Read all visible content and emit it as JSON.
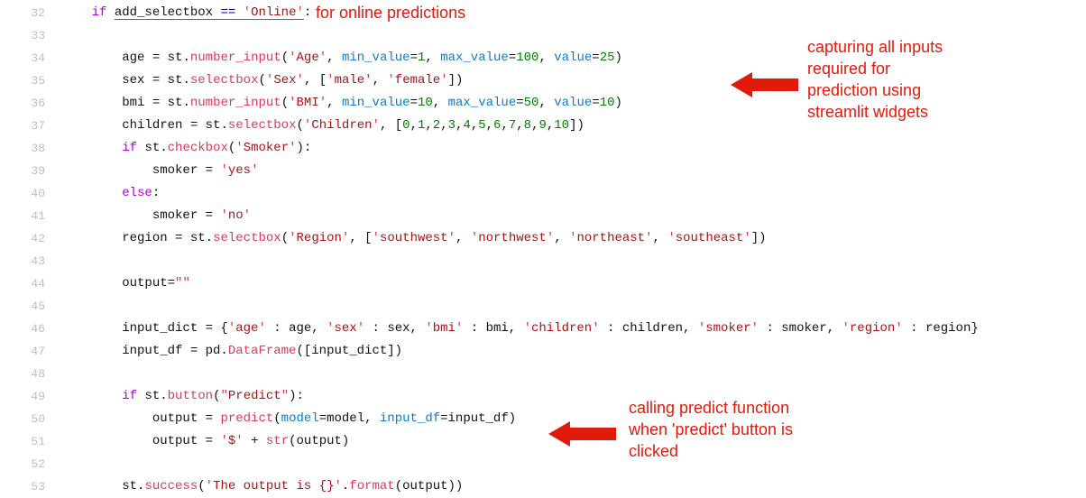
{
  "gutter": {
    "start": 32,
    "end": 53
  },
  "colors": {
    "str": "#a31515",
    "kw": "#af00db",
    "fn": "#dc3958",
    "num": "#008000",
    "param": "#0e7acc",
    "op": "#000080",
    "annot": "#e11a0c"
  },
  "code": {
    "l32": {
      "indent1": "    ",
      "if": "if",
      "sp1": " ",
      "var": "add_selectbox",
      "sp2": " ",
      "eq": "==",
      "sp3": " ",
      "q1": "'",
      "s": "Online",
      "q2": "'",
      "colon": ":"
    },
    "l34": {
      "indent": "        ",
      "lhs": "age",
      "assign": " = ",
      "obj": "st.",
      "fn": "number_input",
      "open": "(",
      "q1": "'",
      "s": "Age",
      "q2": "'",
      "c1": ", ",
      "p1": "min_value",
      "eq1": "=",
      "n1": "1",
      "c2": ", ",
      "p2": "max_value",
      "eq2": "=",
      "n2": "100",
      "c3": ", ",
      "p3": "value",
      "eq3": "=",
      "n3": "25",
      "close": ")"
    },
    "l35": {
      "indent": "        ",
      "lhs": "sex",
      "assign": " = ",
      "obj": "st.",
      "fn": "selectbox",
      "open": "(",
      "q1": "'",
      "s": "Sex",
      "q2": "'",
      "c1": ", [",
      "qa": "'",
      "a": "male",
      "qb": "'",
      "c2": ", ",
      "qc": "'",
      "b": "female",
      "qd": "'",
      "close": "])"
    },
    "l36": {
      "indent": "        ",
      "lhs": "bmi",
      "assign": " = ",
      "obj": "st.",
      "fn": "number_input",
      "open": "(",
      "q1": "'",
      "s": "BMI",
      "q2": "'",
      "c1": ", ",
      "p1": "min_value",
      "eq1": "=",
      "n1": "10",
      "c2": ", ",
      "p2": "max_value",
      "eq2": "=",
      "n2": "50",
      "c3": ", ",
      "p3": "value",
      "eq3": "=",
      "n3": "10",
      "close": ")"
    },
    "l37": {
      "indent": "        ",
      "lhs": "children",
      "assign": " = ",
      "obj": "st.",
      "fn": "selectbox",
      "open": "(",
      "q1": "'",
      "s": "Children",
      "q2": "'",
      "c1": ", [",
      "n0": "0",
      "cm0": ",",
      "n1v": "1",
      "cm1": ",",
      "n2v": "2",
      "cm2": ",",
      "n3v": "3",
      "cm3": ",",
      "n4v": "4",
      "cm4": ",",
      "n5v": "5",
      "cm5": ",",
      "n6v": "6",
      "cm6": ",",
      "n7v": "7",
      "cm7": ",",
      "n8v": "8",
      "cm8": ",",
      "n9v": "9",
      "cm9": ",",
      "n10v": "10",
      "close": "])"
    },
    "l38": {
      "indent": "        ",
      "if": "if",
      "sp": " ",
      "obj": "st.",
      "fn": "checkbox",
      "open": "(",
      "q1": "'",
      "s": "Smoker",
      "q2": "'",
      "close": "):"
    },
    "l39": {
      "indent": "            ",
      "lhs": "smoker = ",
      "q1": "'",
      "s": "yes",
      "q2": "'"
    },
    "l40": {
      "indent": "        ",
      "kw": "else",
      "colon": ":"
    },
    "l41": {
      "indent": "            ",
      "lhs": "smoker = ",
      "q1": "'",
      "s": "no",
      "q2": "'"
    },
    "l42": {
      "indent": "        ",
      "lhs": "region",
      "assign": " = ",
      "obj": "st.",
      "fn": "selectbox",
      "open": "(",
      "q1": "'",
      "s": "Region",
      "q2": "'",
      "c1": ", [",
      "qa": "'",
      "a": "southwest",
      "qb": "'",
      "ca": ", ",
      "qc": "'",
      "b": "northwest",
      "qd": "'",
      "cb": ", ",
      "qe": "'",
      "c": "northeast",
      "qf": "'",
      "cc": ", ",
      "qg": "'",
      "d": "southeast",
      "qh": "'",
      "close": "])"
    },
    "l44": {
      "indent": "        ",
      "lhs": "output=",
      "q1": "\"",
      "q2": "\""
    },
    "l46": {
      "indent": "        ",
      "lhs": "input_dict = {",
      "qa": "'",
      "ka": "age",
      "qb": "'",
      "ca": " : age, ",
      "qc": "'",
      "kb": "sex",
      "qd": "'",
      "cb": " : sex, ",
      "qe": "'",
      "kc": "bmi",
      "qf": "'",
      "cc": " : bmi, ",
      "qg": "'",
      "kd": "children",
      "qh": "'",
      "cd": " : children, ",
      "qi": "'",
      "ke": "smoker",
      "qj": "'",
      "ce": " : smoker, ",
      "qk": "'",
      "kf": "region",
      "ql": "'",
      "cf": " : region}"
    },
    "l47": {
      "indent": "        ",
      "lhs": "input_df = pd.",
      "fn": "DataFrame",
      "args": "([input_dict])"
    },
    "l49": {
      "indent": "        ",
      "if": "if",
      "sp": " ",
      "obj": "st.",
      "fn": "button",
      "open": "(",
      "q1": "\"",
      "s": "Predict",
      "q2": "\"",
      "close": "):"
    },
    "l50": {
      "indent": "            ",
      "lhs": "output = ",
      "fn": "predict",
      "open": "(",
      "p1": "model",
      "eq1": "=model, ",
      "p2": "input_df",
      "eq2": "=input_df)",
      "close": ""
    },
    "l51": {
      "indent": "            ",
      "lhs": "output = ",
      "q1": "'",
      "s": "$",
      "q2": "'",
      "plus": " + ",
      "fn": "str",
      "args": "(output)"
    },
    "l53": {
      "indent": "        ",
      "obj": "st.",
      "fn": "success",
      "open": "(",
      "q1": "'",
      "s": "The output is {}",
      "q2": "'",
      "dot": ".",
      "fmt": "format",
      "args": "(output))"
    }
  },
  "annotations": {
    "a1": "for online predictions",
    "a2": "capturing all inputs\nrequired for\nprediction using\nstreamlit widgets",
    "a3": "calling predict function\nwhen 'predict' button is\nclicked"
  }
}
